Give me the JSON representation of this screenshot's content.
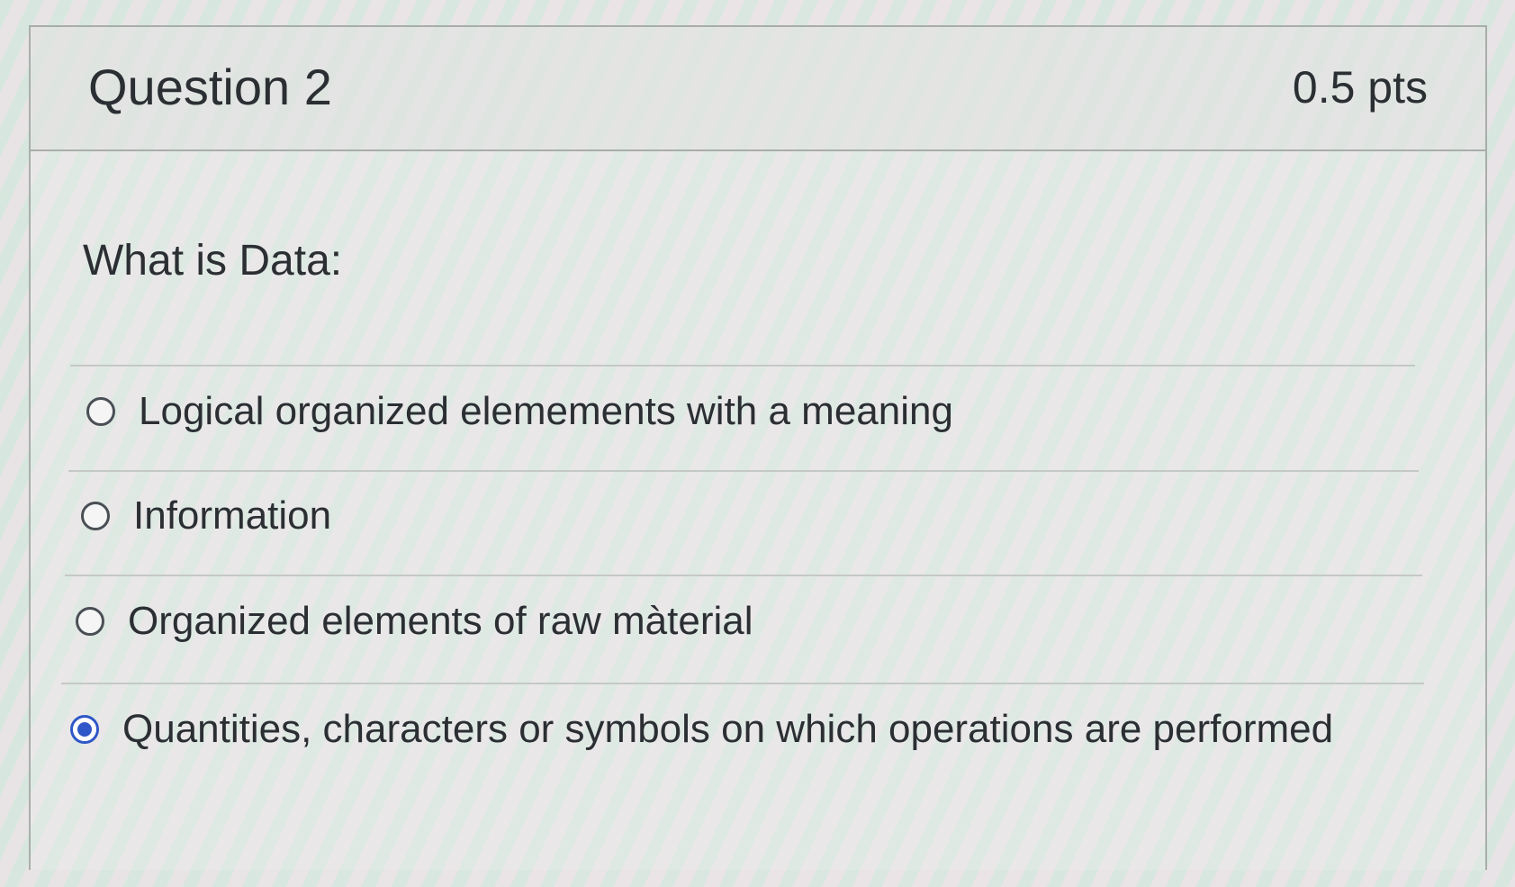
{
  "question": {
    "title": "Question 2",
    "points": "0.5 pts",
    "prompt": "What is Data:"
  },
  "answers": [
    {
      "label": "Logical organized elemements with a meaning",
      "selected": false
    },
    {
      "label": "Information",
      "selected": false
    },
    {
      "label": "Organized elements of raw màterial",
      "selected": false
    },
    {
      "label": "Quantities, characters or symbols on which operations are performed",
      "selected": true
    }
  ],
  "colors": {
    "selected_radio": "#2f57c7",
    "text": "#2b2f33"
  }
}
